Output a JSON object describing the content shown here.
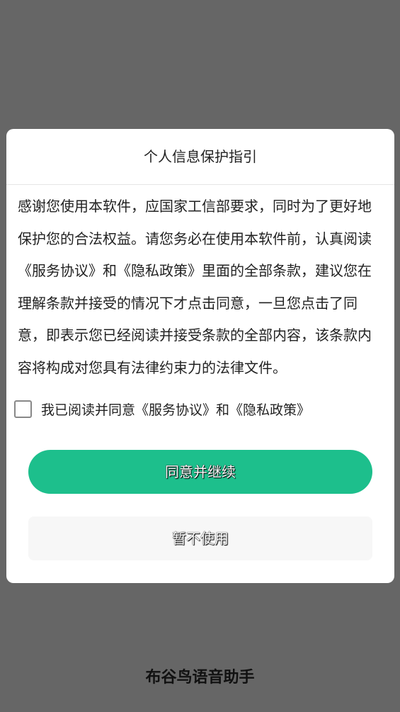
{
  "colors": {
    "backdrop": "#666666",
    "dialog_background": "#ffffff",
    "accent": "#1dbf8c",
    "secondary_button": "#f7f7f7"
  },
  "dialog": {
    "title": "个人信息保护指引",
    "body": "感谢您使用本软件，应国家工信部要求，同时为了更好地保护您的合法权益。请您务必在使用本软件前，认真阅读《服务协议》和《隐私政策》里面的全部条款，建议您在理解条款并接受的情况下才点击同意，一旦您点击了同意，即表示您已经阅读并接受条款的全部内容，该条款内容将构成对您具有法律约束力的法律文件。",
    "consent": {
      "checked": false,
      "label": "我已阅读并同意《服务协议》和《隐私政策》"
    },
    "agree_button": "同意并继续",
    "decline_button": "暂不使用"
  },
  "app": {
    "name": "布谷鸟语音助手"
  }
}
